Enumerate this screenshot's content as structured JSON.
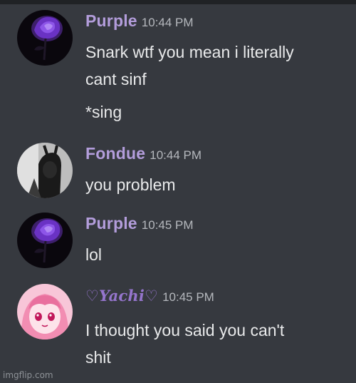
{
  "messages": [
    {
      "username": "Purple",
      "timestamp": "10:44 PM",
      "avatar_icon": "purple-rose-avatar",
      "lines": [
        "Snark wtf you mean i literally",
        "cant sinf",
        "*sing"
      ]
    },
    {
      "username": "Fondue",
      "timestamp": "10:44 PM",
      "avatar_icon": "dark-figure-avatar",
      "lines": [
        "you problem"
      ]
    },
    {
      "username": "Purple",
      "timestamp": "10:45 PM",
      "avatar_icon": "purple-rose-avatar",
      "lines": [
        "lol"
      ]
    },
    {
      "username": "♡Yachi♡",
      "timestamp": "10:45 PM",
      "avatar_icon": "pink-anime-girl-avatar",
      "lines": [
        "I thought you said you can't",
        "shit"
      ]
    }
  ],
  "watermark": "imgflip.com",
  "colors": {
    "background": "#36393f",
    "username": "#b39ddb",
    "timestamp": "#b5b8bd",
    "text": "#e8e9ea"
  }
}
